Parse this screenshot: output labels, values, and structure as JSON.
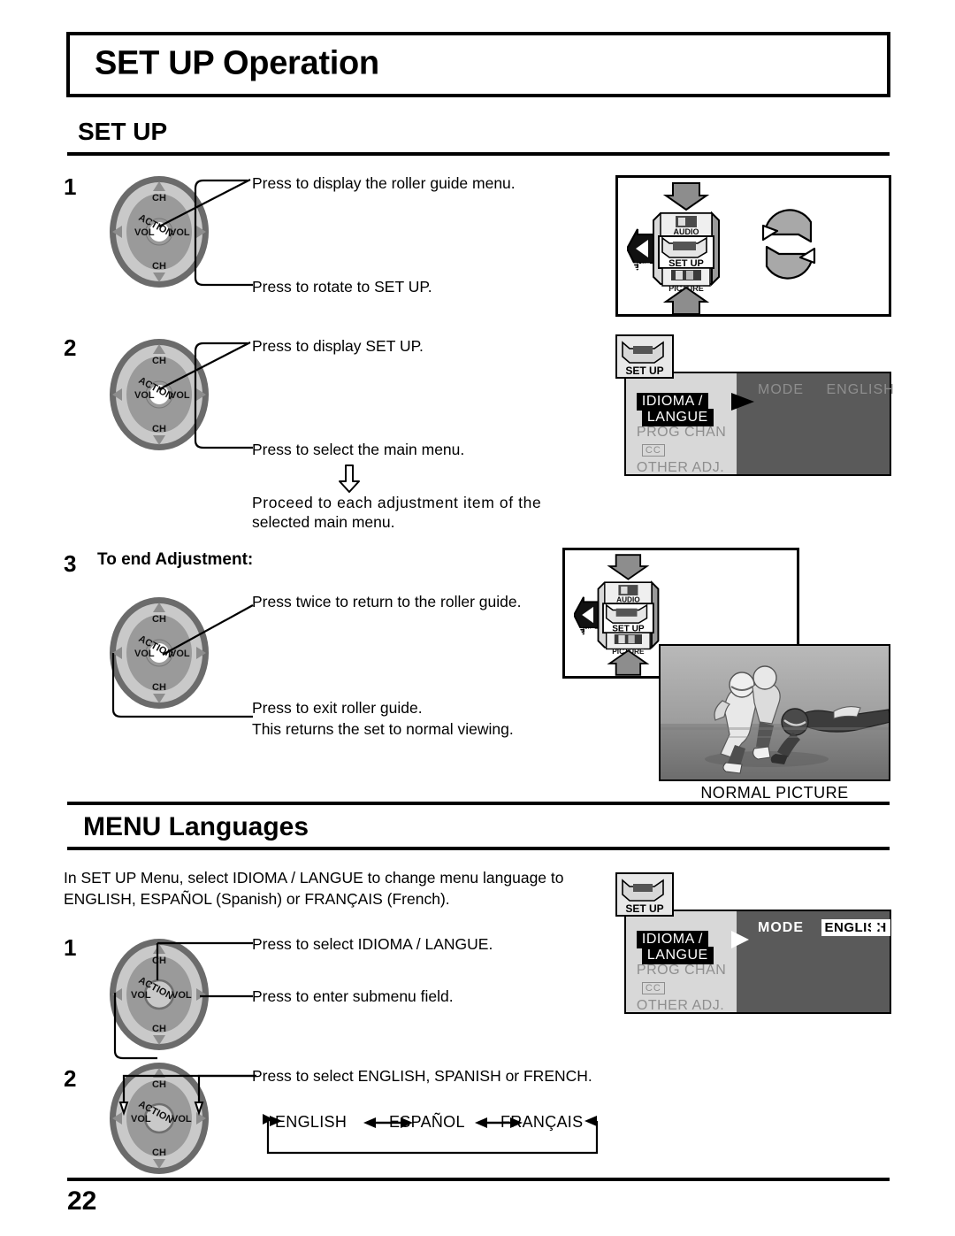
{
  "page": {
    "title": "SET UP Operation",
    "number": "22"
  },
  "section_setup": {
    "heading": "SET UP",
    "steps": [
      {
        "num": "1",
        "line_top": "Press to display the roller guide menu.",
        "line_bottom": "Press to rotate to SET UP."
      },
      {
        "num": "2",
        "line_top": "Press to display SET UP.",
        "line_bottom": "Press to select the main menu.",
        "note_line1": "Proceed to each adjustment item of the",
        "note_line2": "selected main menu."
      },
      {
        "num": "3",
        "label": "To end Adjustment:",
        "line_top": "Press twice to return to the roller guide.",
        "line_bottom1": "Press to exit roller guide.",
        "line_bottom2": "This returns the set to normal viewing."
      }
    ],
    "picture_caption": "NORMAL PICTURE"
  },
  "section_languages": {
    "heading": "MENU Languages",
    "intro_line1": "In SET UP Menu, select IDIOMA / LANGUE to change menu language to",
    "intro_line2": "ENGLISH, ESPAÑOL (Spanish) or FRANÇAIS (French).",
    "steps": [
      {
        "num": "1",
        "line_top": "Press to select IDIOMA / LANGUE.",
        "line_bottom": "Press to enter submenu field."
      },
      {
        "num": "2",
        "line_top": "Press to select ENGLISH, SPANISH or FRENCH."
      }
    ],
    "cycle": [
      "ENGLISH",
      "ESPAÑOL",
      "FRANÇAIS"
    ]
  },
  "wheel": {
    "ch_top": "CH",
    "ch_bottom": "CH",
    "vol_left": "VOL",
    "vol_right": "VOL",
    "action": "ACTION"
  },
  "roller_guide": {
    "audio": "AUDIO",
    "setup": "SET UP",
    "picture": "PICTURE",
    "exit": "EXIT"
  },
  "osd_menu_1": {
    "tab": "SET UP",
    "items": [
      "IDIOMA /",
      "LANGUE",
      "PROG  CHAN",
      "CC",
      "OTHER  ADJ."
    ],
    "field_label": "MODE",
    "field_value": "ENGLISH"
  },
  "osd_menu_2": {
    "tab": "SET UP",
    "items": [
      "IDIOMA /",
      "LANGUE",
      "PROG  CHAN",
      "CC",
      "OTHER  ADJ."
    ],
    "field_label": "MODE",
    "field_value": "ENGLISH"
  },
  "colors": {
    "osd_background": "#5a5a5a",
    "osd_sidebar": "#d8d8d8",
    "osd_dim_text": "#8e8e8e",
    "selection": "#000000",
    "wheel_outer": "#6b6b6b",
    "wheel_mid": "#c9c9c9",
    "wheel_inner": "#9a9a9a"
  }
}
